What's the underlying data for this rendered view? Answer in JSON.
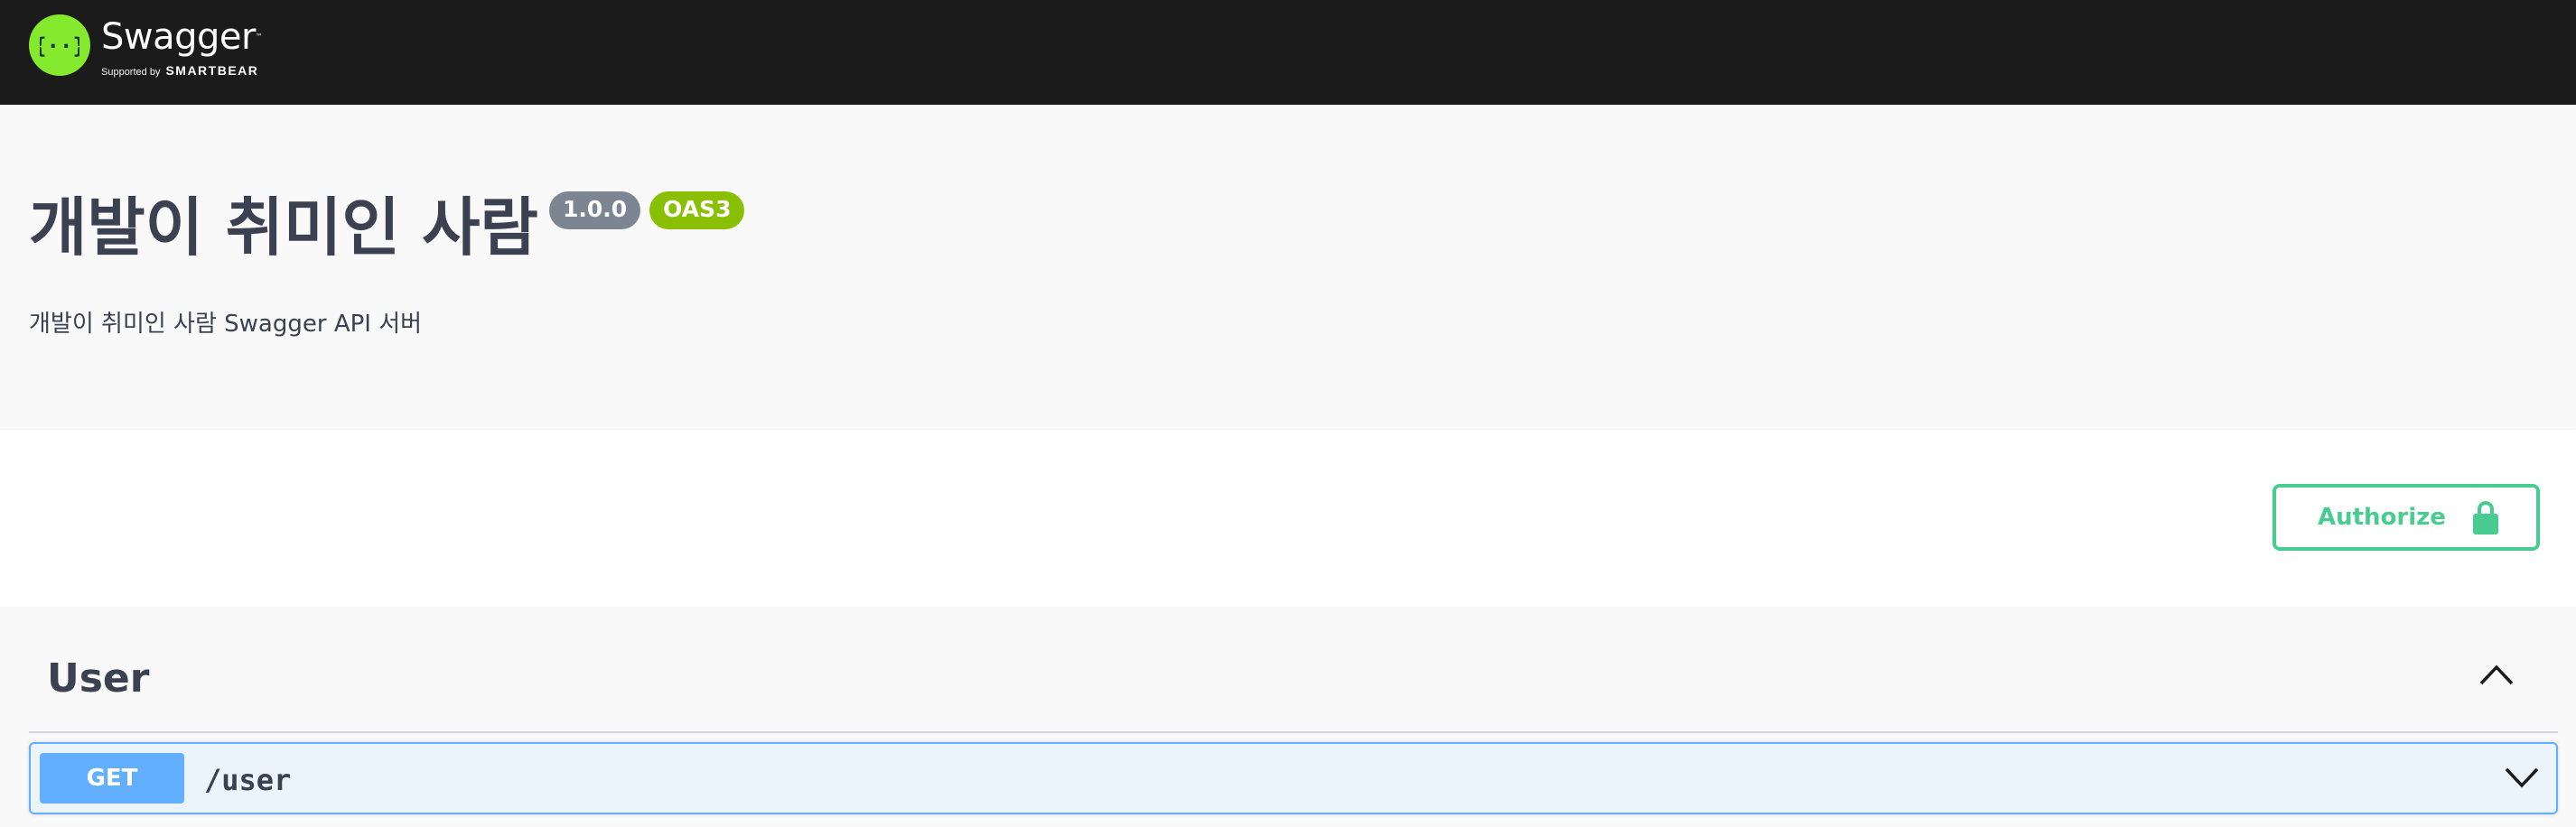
{
  "topbar": {
    "brand_name": "Swagger",
    "tm": "™",
    "supported_by": "Supported by",
    "supporter": "SMARTBEAR",
    "logo_color": "#85ea2d"
  },
  "info": {
    "title": "개발이 취미인 사람",
    "version": "1.0.0",
    "spec_badge": "OAS3",
    "description": "개발이 취미인 사람 Swagger API 서버"
  },
  "auth": {
    "button_label": "Authorize",
    "icon": "lock-icon",
    "color": "#49cc90"
  },
  "tags": [
    {
      "name": "User",
      "expanded": true,
      "toggle_icon": "chevron-up-icon",
      "operations": [
        {
          "method": "GET",
          "path": "/user",
          "method_color": "#61affe",
          "toggle_icon": "chevron-down-icon"
        }
      ]
    }
  ]
}
